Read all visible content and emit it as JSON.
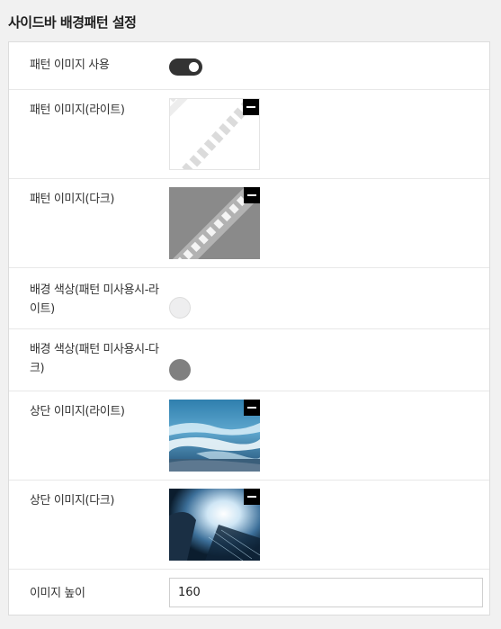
{
  "section": {
    "title": "사이드바 배경패턴 설정"
  },
  "settings": {
    "pattern_toggle": {
      "label": "패턴 이미지 사용",
      "enabled": true
    },
    "pattern_light": {
      "label": "패턴 이미지(라이트)",
      "remove_icon": "minus-icon"
    },
    "pattern_dark": {
      "label": "패턴 이미지(다크)",
      "remove_icon": "minus-icon"
    },
    "bg_color_light": {
      "label": "배경 색상(패턴 미사용시-라이트)",
      "color": "#eeeeef"
    },
    "bg_color_dark": {
      "label": "배경 색상(패턴 미사용시-다크)",
      "color": "#808080"
    },
    "top_image_light": {
      "label": "상단 이미지(라이트)",
      "remove_icon": "minus-icon"
    },
    "top_image_dark": {
      "label": "상단 이미지(다크)",
      "remove_icon": "minus-icon"
    },
    "image_height": {
      "label": "이미지 높이",
      "value": "160"
    }
  }
}
